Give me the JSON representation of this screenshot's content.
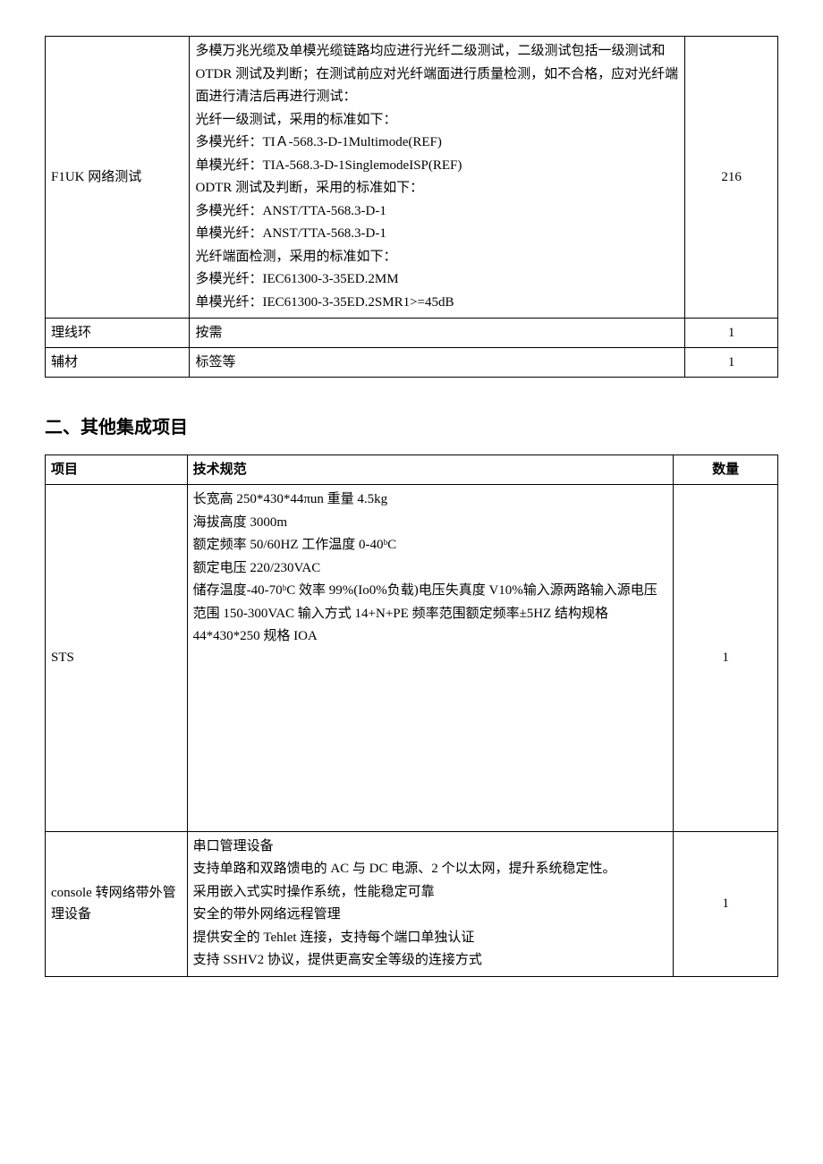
{
  "table1": {
    "rows": [
      {
        "project": "F1UK 网络测试",
        "spec": "多模万兆光缆及单模光缆链路均应进行光纤二级测试，二级测试包括一级测试和 OTDR 测试及判断；在测试前应对光纤端面进行质量检测，如不合格，应对光纤端面进行清洁后再进行测试：\n光纤一级测试，采用的标准如下：\n多模光纤：TIＡ-568.3-D-1Multimode(REF)\n单模光纤：TIA-568.3-D-1SinglemodeISP(REF)\nODTR 测试及判断，采用的标准如下：\n多模光纤：ANST/TTA-568.3-D-1\n单模光纤：ANST/TTA-568.3-D-1\n光纤端面检测，采用的标准如下：\n多模光纤：IEC61300-3-35ED.2MM\n单模光纤：IEC61300-3-35ED.2SMR1>=45dB",
        "qty": "216"
      },
      {
        "project": "理线环",
        "spec": "按需",
        "qty": "1"
      },
      {
        "project": "辅材",
        "spec": "标签等",
        "qty": "1"
      }
    ]
  },
  "section2_title": "二、其他集成项目",
  "table2": {
    "headers": {
      "project": "项目",
      "spec": "技术规范",
      "qty": "数量"
    },
    "rows": [
      {
        "project": "STS",
        "spec": "长宽高 250*430*44πun 重量 4.5kg\n海拔高度 3000m\n额定频率 50/60HZ 工作温度 0-40ᵇC\n额定电压 220/230VAC\n储存温度-40-70ᵇC 效率 99%(Io0%负载)电压失真度 V10%输入源两路输入源电压范围 150-300VAC 输入方式 14+N+PE 频率范围额定频率±5HZ 结构规格 44*430*250 规格 IOA",
        "qty": "1",
        "pad": true
      },
      {
        "project": "console 转网络带外管理设备",
        "spec": "串口管理设备\n支持单路和双路馈电的 AC 与 DC 电源、2 个以太网，提升系统稳定性。\n采用嵌入式实时操作系统，性能稳定可靠\n安全的带外网络远程管理\n提供安全的 Tehlet 连接，支持每个端口单独认证\n支持 SSHV2 协议，提供更高安全等级的连接方式",
        "qty": "1"
      }
    ]
  }
}
